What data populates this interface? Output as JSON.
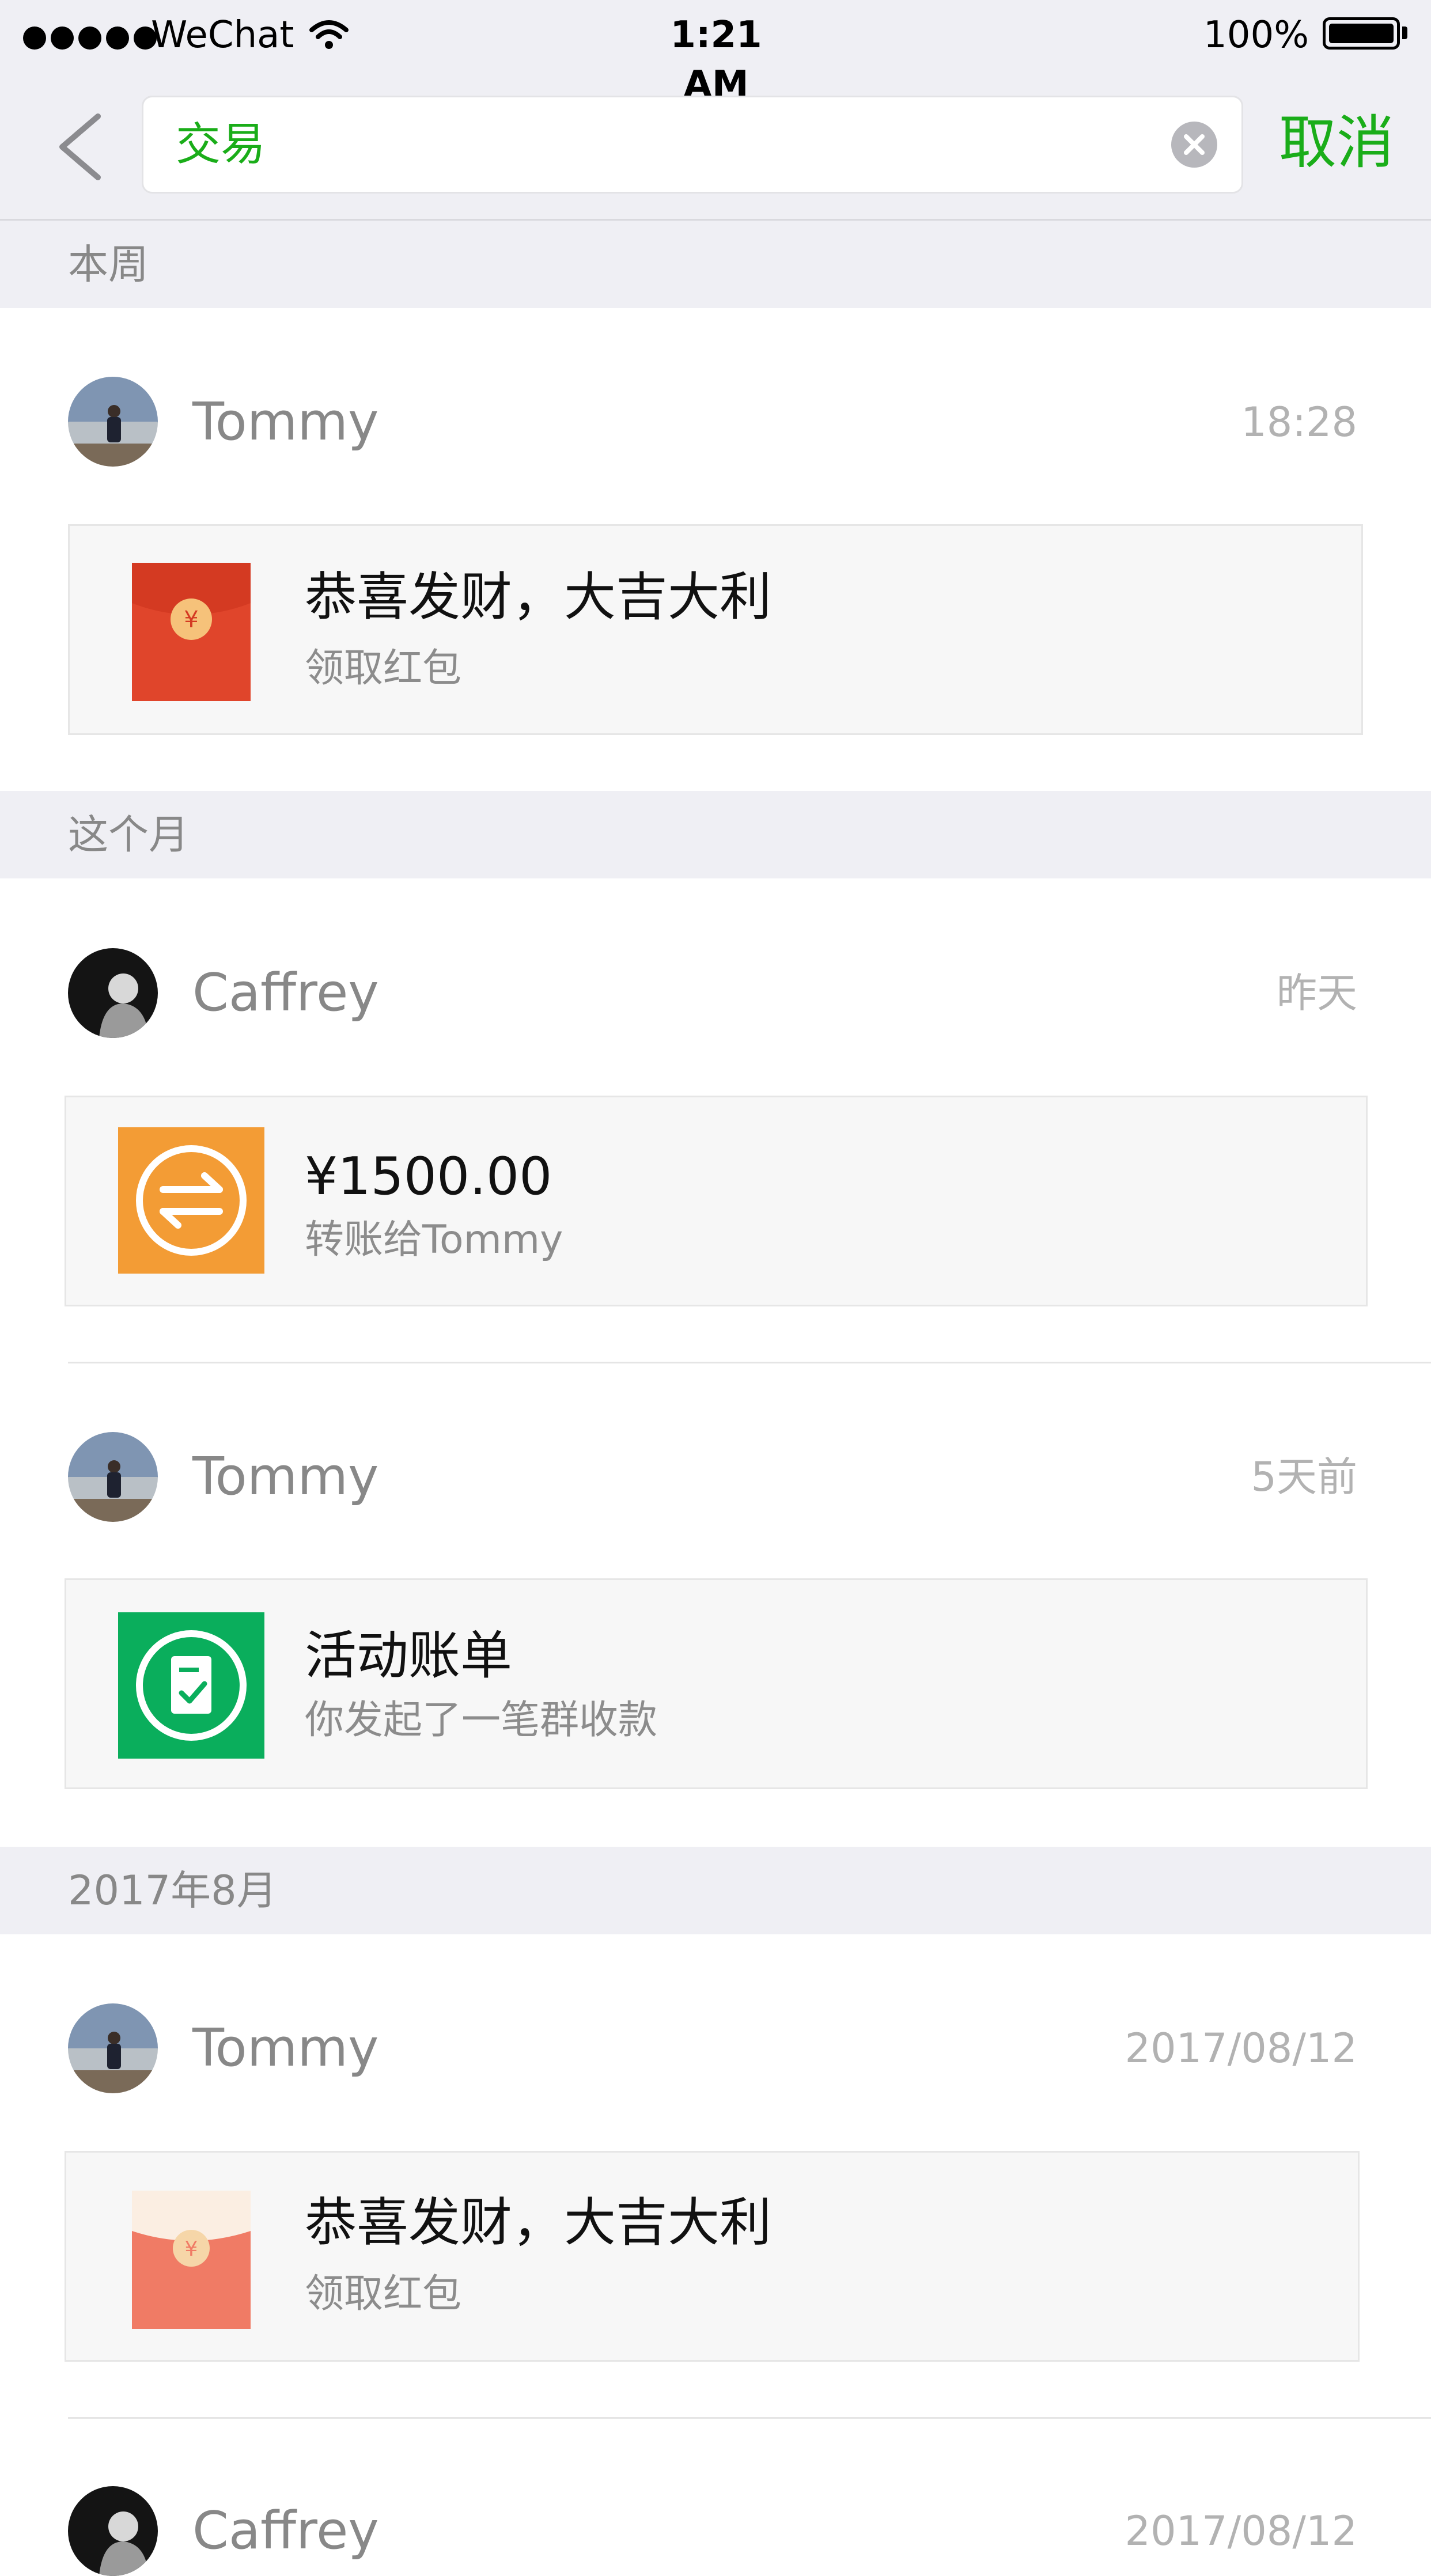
{
  "status_bar": {
    "carrier": "WeChat",
    "time": "1:21 AM",
    "battery": "100%"
  },
  "search": {
    "query": "交易",
    "cancel_label": "取消"
  },
  "sections": [
    {
      "title": "本周"
    },
    {
      "title": "这个月"
    },
    {
      "title": "2017年8月"
    }
  ],
  "items": [
    {
      "name": "Tommy",
      "time": "18:28",
      "title": "恭喜发财，大吉大利",
      "subtitle": "领取红包",
      "icon": "red-packet-icon"
    },
    {
      "name": "Caffrey",
      "time": "昨天",
      "title": "¥1500.00",
      "subtitle": "转账给Tommy",
      "icon": "transfer-icon"
    },
    {
      "name": "Tommy",
      "time": "5天前",
      "title": "活动账单",
      "subtitle": "你发起了一笔群收款",
      "icon": "group-bill-icon"
    },
    {
      "name": "Tommy",
      "time": "2017/08/12",
      "title": "恭喜发财，大吉大利",
      "subtitle": "领取红包",
      "icon": "opened-red-packet-icon"
    },
    {
      "name": "Caffrey",
      "time": "2017/08/12"
    }
  ],
  "colors": {
    "accent_green": "#1aad19",
    "red_packet": "#e0452b",
    "transfer_orange": "#f39c35",
    "bill_green": "#0aae5c",
    "opened_packet": "#f07b65"
  }
}
